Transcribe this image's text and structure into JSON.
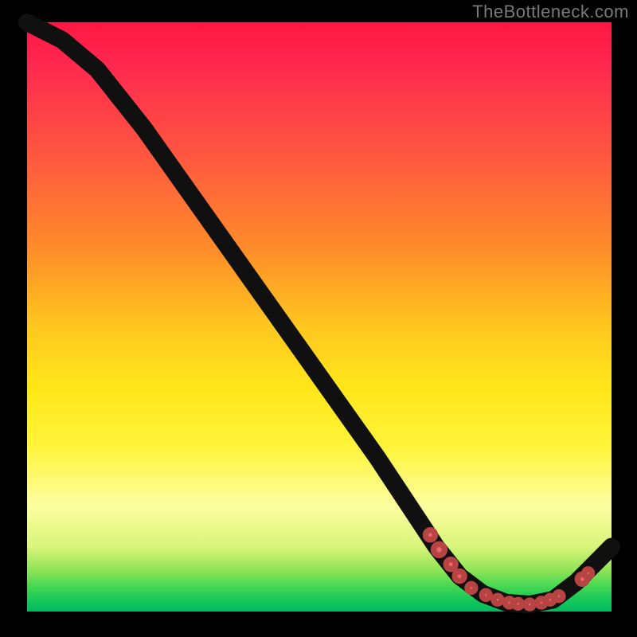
{
  "attribution": "TheBottleneck.com",
  "chart_data": {
    "type": "line",
    "xlim": [
      0,
      100
    ],
    "ylim": [
      0,
      100
    ],
    "curve": [
      {
        "x": 0,
        "y": 100
      },
      {
        "x": 6,
        "y": 97
      },
      {
        "x": 12,
        "y": 92
      },
      {
        "x": 20,
        "y": 82
      },
      {
        "x": 30,
        "y": 68
      },
      {
        "x": 40,
        "y": 54
      },
      {
        "x": 50,
        "y": 40
      },
      {
        "x": 60,
        "y": 26
      },
      {
        "x": 66,
        "y": 17
      },
      {
        "x": 70,
        "y": 11
      },
      {
        "x": 74,
        "y": 6
      },
      {
        "x": 78,
        "y": 3
      },
      {
        "x": 82,
        "y": 1.5
      },
      {
        "x": 86,
        "y": 1.2
      },
      {
        "x": 90,
        "y": 2
      },
      {
        "x": 94,
        "y": 5
      },
      {
        "x": 97,
        "y": 8
      },
      {
        "x": 100,
        "y": 11
      }
    ],
    "markers": [
      {
        "x": 69,
        "y": 13,
        "r": 6
      },
      {
        "x": 70.5,
        "y": 10.5,
        "r": 7
      },
      {
        "x": 72.5,
        "y": 8,
        "r": 6
      },
      {
        "x": 74,
        "y": 6,
        "r": 6
      },
      {
        "x": 76,
        "y": 4,
        "r": 5
      },
      {
        "x": 78.5,
        "y": 2.8,
        "r": 5
      },
      {
        "x": 80.5,
        "y": 2,
        "r": 5
      },
      {
        "x": 82.5,
        "y": 1.5,
        "r": 5
      },
      {
        "x": 84,
        "y": 1.3,
        "r": 5
      },
      {
        "x": 86,
        "y": 1.2,
        "r": 5
      },
      {
        "x": 88,
        "y": 1.5,
        "r": 5
      },
      {
        "x": 89.5,
        "y": 2,
        "r": 5
      },
      {
        "x": 91,
        "y": 2.6,
        "r": 5
      },
      {
        "x": 95,
        "y": 5.5,
        "r": 6
      },
      {
        "x": 96,
        "y": 6.5,
        "r": 5
      }
    ]
  }
}
